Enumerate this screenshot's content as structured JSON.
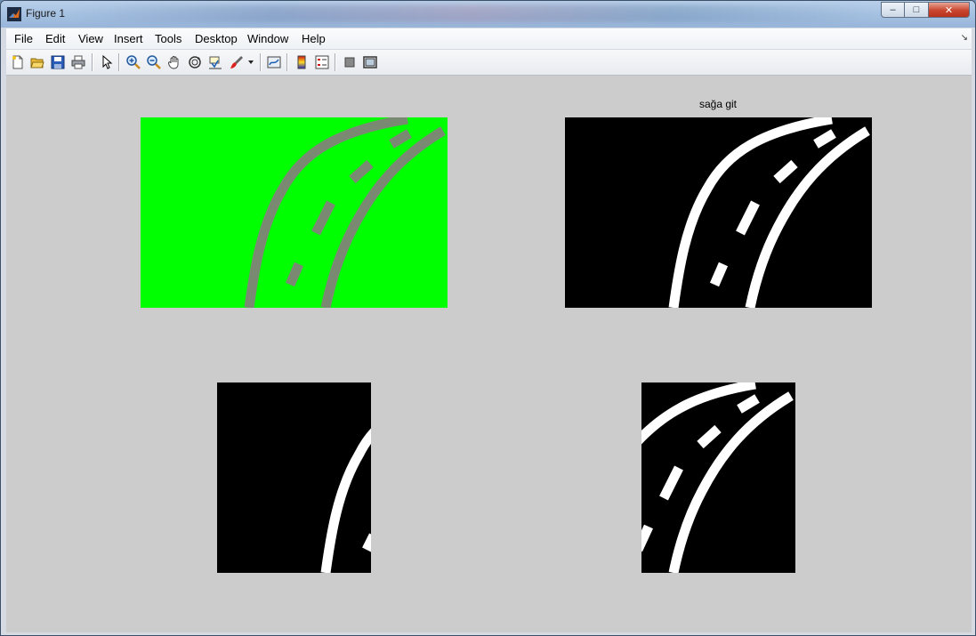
{
  "window": {
    "title": "Figure 1",
    "controls": {
      "minimize": "–",
      "maximize": "□",
      "close": "✕"
    }
  },
  "menubar": {
    "items": [
      "File",
      "Edit",
      "View",
      "Insert",
      "Tools",
      "Desktop",
      "Window",
      "Help"
    ],
    "overflow_icon": "corner-arrow-icon"
  },
  "toolbar": {
    "buttons": [
      {
        "icon": "new-figure-icon"
      },
      {
        "icon": "open-file-icon"
      },
      {
        "icon": "save-icon"
      },
      {
        "icon": "print-icon"
      },
      {
        "icon": "edit-plot-arrow-icon"
      },
      {
        "icon": "zoom-in-icon"
      },
      {
        "icon": "zoom-out-icon"
      },
      {
        "icon": "pan-hand-icon"
      },
      {
        "icon": "rotate-3d-icon"
      },
      {
        "icon": "data-cursor-icon"
      },
      {
        "icon": "brush-icon"
      },
      {
        "icon": "link-plot-icon"
      },
      {
        "icon": "colorbar-icon"
      },
      {
        "icon": "legend-icon"
      },
      {
        "icon": "hide-plot-tools-icon"
      },
      {
        "icon": "show-plot-tools-icon"
      }
    ]
  },
  "figure": {
    "background": "#cccccc",
    "subplots": [
      {
        "name": "road-color-image",
        "title": "",
        "colors": {
          "background": "#00ff00",
          "lines": "#7a8a72"
        }
      },
      {
        "name": "road-binary-image",
        "title": "sağa git",
        "colors": {
          "background": "#000000",
          "lines": "#ffffff"
        }
      },
      {
        "name": "left-half-binary",
        "title": "",
        "colors": {
          "background": "#000000",
          "lines": "#ffffff"
        }
      },
      {
        "name": "right-half-binary",
        "title": "",
        "colors": {
          "background": "#000000",
          "lines": "#ffffff"
        }
      }
    ]
  }
}
